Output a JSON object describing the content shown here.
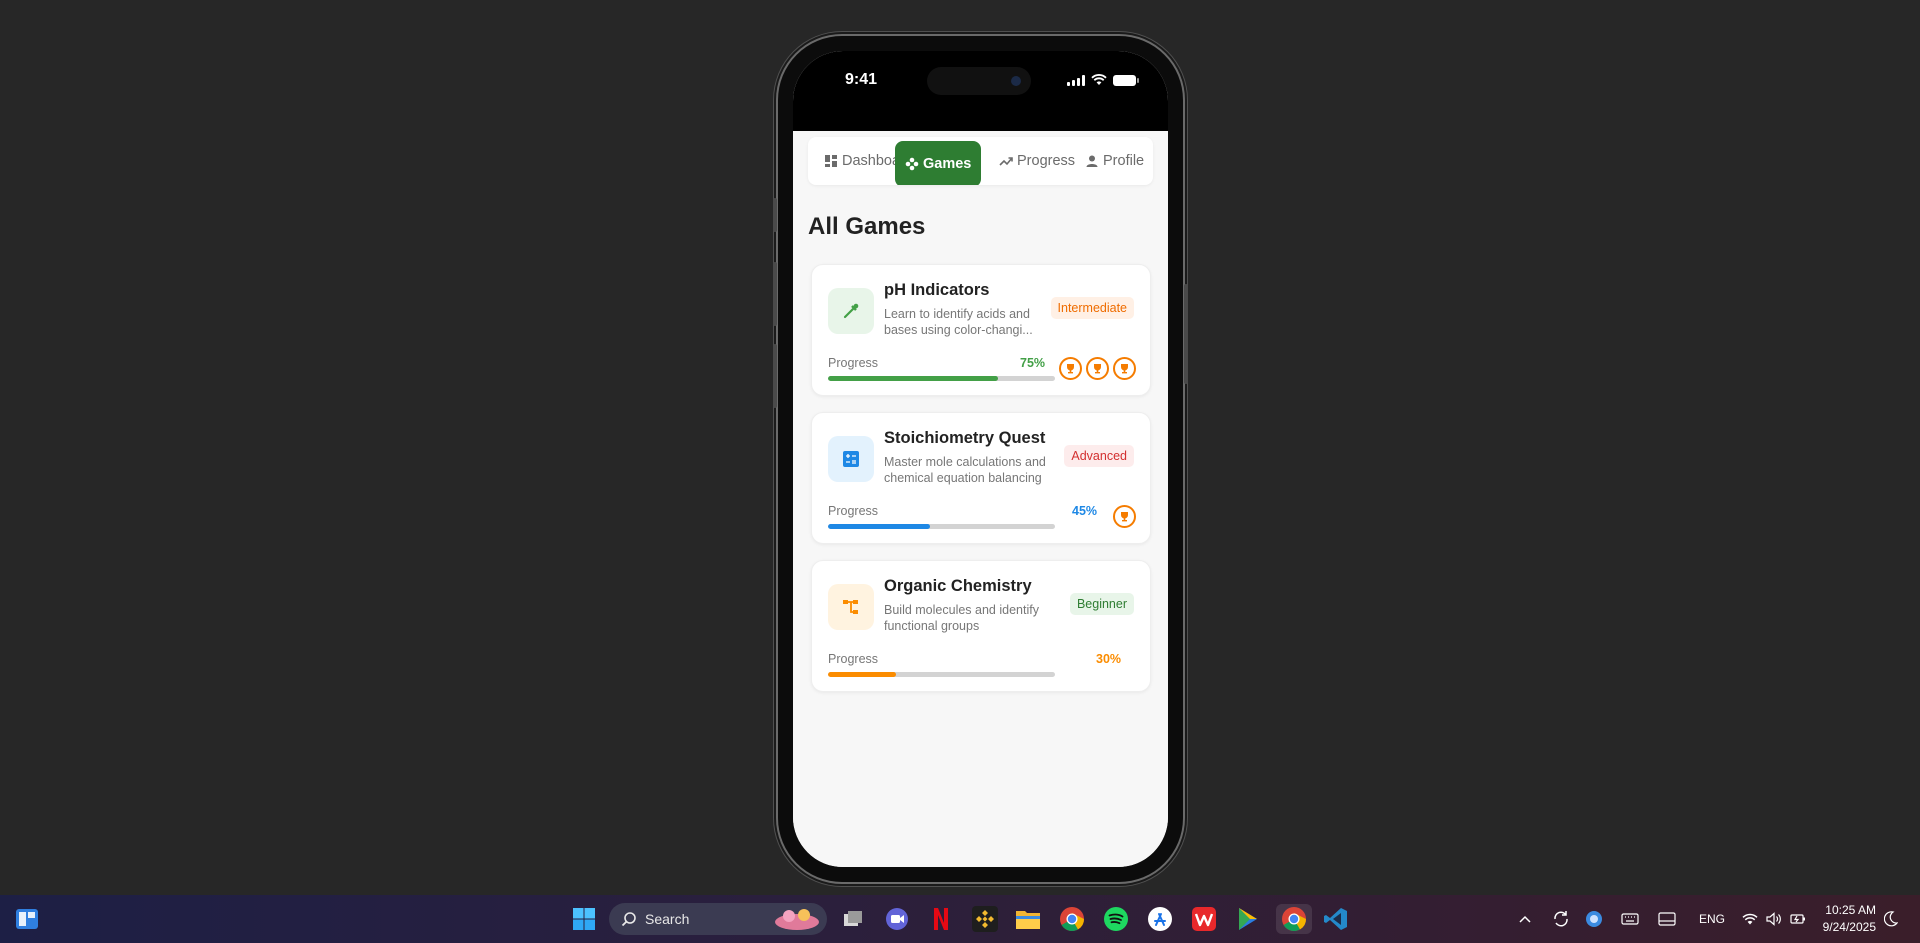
{
  "status_bar": {
    "time": "9:41"
  },
  "nav": {
    "tabs": [
      {
        "label": "Dashboard",
        "icon": "dashboard-icon",
        "active": false
      },
      {
        "label": "Games",
        "icon": "gamepad-icon",
        "active": true
      },
      {
        "label": "Progress",
        "icon": "trending-up-icon",
        "active": false
      },
      {
        "label": "Profile",
        "icon": "person-icon",
        "active": false
      }
    ]
  },
  "page_title": "All Games",
  "games": [
    {
      "name": "pH Indicators",
      "description": "Learn to identify acids and bases using color-changi...",
      "level": "Intermediate",
      "progress_label": "Progress",
      "progress_text": "75%",
      "progress": 0.75,
      "trophies": 3,
      "icon": "eyedropper-icon",
      "accent": "#43a047",
      "badge_bg": "#fff0e5",
      "badge_color": "#ef6c00"
    },
    {
      "name": "Stoichiometry Quest",
      "description": "Master mole calculations and chemical equation balancing",
      "level": "Advanced",
      "progress_label": "Progress",
      "progress_text": "45%",
      "progress": 0.45,
      "trophies": 1,
      "icon": "calculator-icon",
      "accent": "#1e88e5",
      "badge_bg": "#fdecec",
      "badge_color": "#d32f2f"
    },
    {
      "name": "Organic Chemistry",
      "description": "Build molecules and identify functional groups",
      "level": "Beginner",
      "progress_label": "Progress",
      "progress_text": "30%",
      "progress": 0.3,
      "trophies": 0,
      "icon": "molecule-structure-icon",
      "accent": "#fb8c00",
      "badge_bg": "#e8f5e9",
      "badge_color": "#2e7d32"
    }
  ],
  "taskbar": {
    "search_label": "Search",
    "language": "ENG",
    "clock_time": "10:25 AM",
    "clock_date": "9/24/2025"
  }
}
